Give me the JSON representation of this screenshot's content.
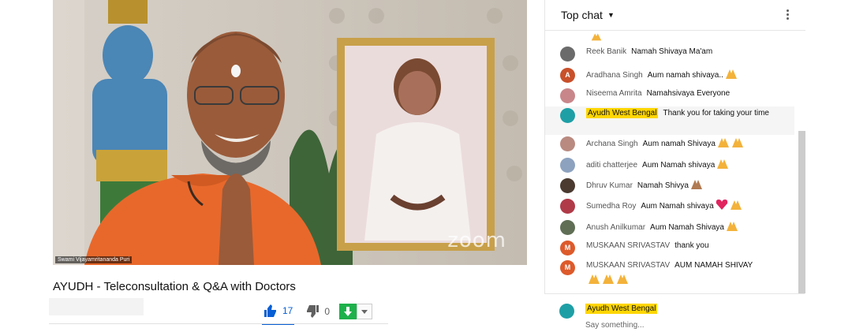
{
  "video": {
    "speaker_label": "Swami Vijayamritananda Puri",
    "watermark": "zoom"
  },
  "title": "AYUDH - Teleconsultation & Q&A with Doctors",
  "actions": {
    "likes": "17",
    "dislikes": "0"
  },
  "chat": {
    "header": "Top chat",
    "messages": [
      {
        "author": "Reek Banik",
        "text": "Namah Shivaya Ma'am",
        "avatar_color": "#6b6b6b",
        "avatar_letter": "",
        "emoji": []
      },
      {
        "author": "Aradhana Singh",
        "text": "Aum namah shivaya..",
        "avatar_color": "#c8502a",
        "avatar_letter": "A",
        "emoji": [
          "pray"
        ]
      },
      {
        "author": "Niseema Amrita",
        "text": "Namahsivaya Everyone",
        "avatar_color": "#c9868a",
        "avatar_letter": "",
        "emoji": []
      },
      {
        "author": "Ayudh West Bengal",
        "text": "Thank you for taking your time",
        "avatar_color": "#1e9fa6",
        "avatar_letter": "",
        "emoji": [],
        "owner": true
      },
      {
        "author": "Archana Singh",
        "text": "Aum namah Shivaya",
        "avatar_color": "#b98a80",
        "avatar_letter": "",
        "emoji": [
          "pray",
          "pray"
        ]
      },
      {
        "author": "aditi chatterjee",
        "text": "Aum Namah shivaya",
        "avatar_color": "#8da2bf",
        "avatar_letter": "",
        "emoji": [
          "pray"
        ]
      },
      {
        "author": "Dhruv Kumar",
        "text": "Namah Shivya",
        "avatar_color": "#4a3a30",
        "avatar_letter": "",
        "emoji": [
          "pray-dark"
        ]
      },
      {
        "author": "Sumedha Roy",
        "text": "Aum Namah shivaya",
        "avatar_color": "#b03a48",
        "avatar_letter": "",
        "emoji": [
          "heart",
          "pray"
        ]
      },
      {
        "author": "Anush Anilkumar",
        "text": "Aum Namah Shivaya",
        "avatar_color": "#5f6e55",
        "avatar_letter": "",
        "emoji": [
          "pray"
        ]
      },
      {
        "author": "MUSKAAN SRIVASTAV",
        "text": "thank you",
        "avatar_color": "#dd5a2b",
        "avatar_letter": "M",
        "emoji": []
      },
      {
        "author": "MUSKAAN SRIVASTAV",
        "text": "AUM NAMAH SHIVAY",
        "avatar_color": "#dd5a2b",
        "avatar_letter": "M",
        "emoji": [
          "pray",
          "pray",
          "pray"
        ]
      }
    ]
  },
  "input": {
    "user": "Ayudh West Bengal",
    "placeholder": "Say something..."
  },
  "colors": {
    "accent_blue": "#065fd4",
    "owner_highlight": "#ffd600",
    "download_green": "#1db14b",
    "video_orange": "#e8682b"
  }
}
